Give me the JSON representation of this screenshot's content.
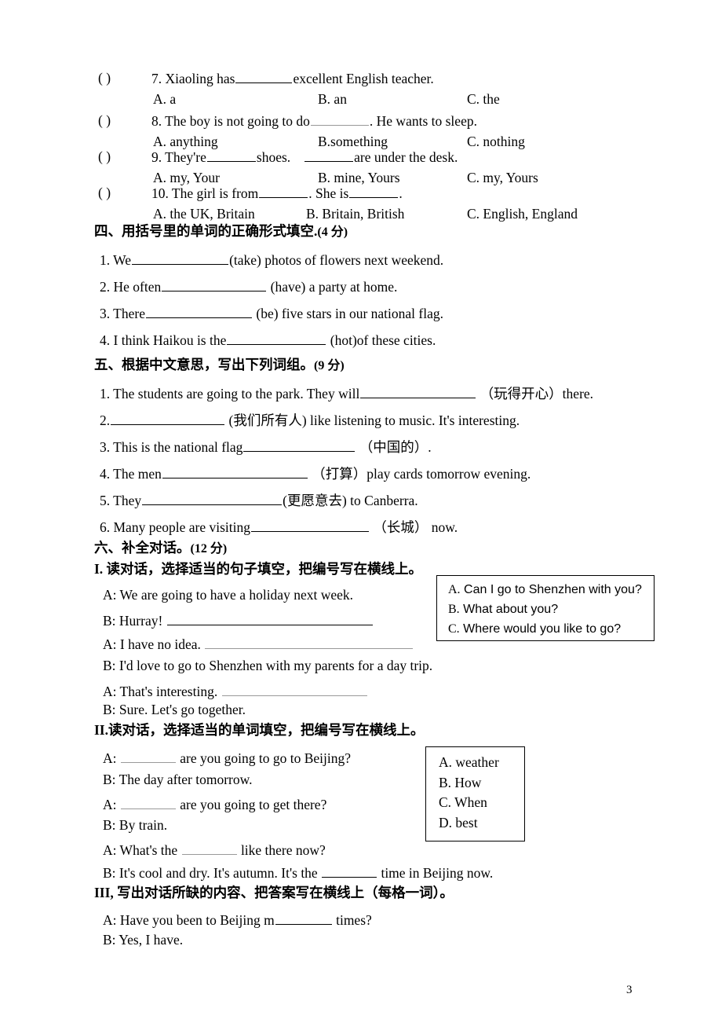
{
  "page_number": "3",
  "multiple_choice": {
    "marker": "(      )",
    "questions": [
      {
        "stem_pre": "7. Xiaoling has",
        "stem_post": "excellent English teacher.",
        "options": [
          "A. a",
          "B. an",
          "C. the"
        ]
      },
      {
        "stem_pre": "8. The boy is not going to do",
        "stem_post": ". He wants to sleep.",
        "options": [
          "A. anything",
          "B.something",
          "C. nothing"
        ]
      },
      {
        "stem_pre": "9. They're",
        "stem_mid": "shoes.",
        "stem_post": "are under the desk.",
        "options": [
          "A. my, Your",
          "B. mine, Yours",
          "C. my, Yours"
        ]
      },
      {
        "stem_pre": "10. The girl is from",
        "stem_mid": ". She is",
        "stem_post": ".",
        "options": [
          "A. the UK, Britain",
          "B. Britain, British",
          "C. English, England"
        ]
      }
    ]
  },
  "section_four": {
    "heading": "四、用括号里的单词的正确形式填空.",
    "points": "(4 分)",
    "items": [
      {
        "pre": "1. We",
        "post": "(take) photos of flowers next weekend."
      },
      {
        "pre": "2. He often",
        "post": "(have) a party at home."
      },
      {
        "pre": "3. There",
        "post": "(be) five stars in our national flag."
      },
      {
        "pre": "4.   I think Haikou is the",
        "post": "(hot)of these cities."
      }
    ]
  },
  "section_five": {
    "heading": "五、根据中文意思，写出下列词组。",
    "points": "(9 分)",
    "items": [
      {
        "pre": "1. The students are going to the park. They will",
        "post": "（玩得开心）there."
      },
      {
        "pre": "2.",
        "post": "(我们所有人) like listening to music. It's interesting."
      },
      {
        "pre": "3. This is the national flag",
        "post": "（中国的）."
      },
      {
        "pre": "4. The men",
        "post": "（打算）play cards tomorrow evening."
      },
      {
        "pre": "5. They",
        "post": "(更愿意去) to Canberra."
      },
      {
        "pre": "6. Many people are visiting",
        "post": "（长城） now."
      }
    ]
  },
  "section_six": {
    "heading": "六、补全对话。",
    "points": "(12 分)",
    "part_one": {
      "heading": "I. 读对话，选择适当的句子填空，把编号写在横线上。",
      "lines": [
        {
          "text": "A: We are going to have a holiday next week.",
          "blank": "none"
        },
        {
          "text": "B: Hurray!",
          "blank": "solid"
        },
        {
          "text": "A: I have no idea.",
          "blank": "dotted"
        },
        {
          "text": "B: I'd love to go to Shenzhen with my parents for a day trip.",
          "blank": "none"
        },
        {
          "text": "A: That's interesting.",
          "blank": "dotted"
        },
        {
          "text": "B: Sure. Let's go together.",
          "blank": "none"
        }
      ],
      "options": [
        {
          "letter": "A.",
          "text": "Can I go to Shenzhen with you?"
        },
        {
          "letter": "B.",
          "text": "What about you?"
        },
        {
          "letter": "C.",
          "text": "Where would you like to go?"
        }
      ]
    },
    "part_two": {
      "heading": "II.读对话，选择适当的单词填空，把编号写在横线上。",
      "lines": [
        {
          "pre": "A:",
          "post": "are you going to go to Beijing?",
          "blank": true
        },
        {
          "pre": "B: The day after tomorrow.",
          "post": "",
          "blank": false
        },
        {
          "pre": "A:",
          "post": "are you going to get there?",
          "blank": true
        },
        {
          "pre": "B: By train.",
          "post": "",
          "blank": false
        },
        {
          "pre": "A: What's the",
          "post": "like there now?",
          "blank": true
        },
        {
          "pre": "B: It's cool and dry. It's autumn. It's the",
          "post": "time in Beijing now.",
          "blank": true
        }
      ],
      "options": [
        "A. weather",
        "B. How",
        "C. When",
        "D. best"
      ]
    },
    "part_three": {
      "heading": "III, 写出对话所缺的内容、把答案写在横线上（每格一词）。",
      "lines": [
        {
          "pre": "A: Have you been to Beijing   m",
          "post": "times?",
          "blank": true
        },
        {
          "pre": "B: Yes, I have.",
          "post": "",
          "blank": false
        }
      ]
    }
  }
}
